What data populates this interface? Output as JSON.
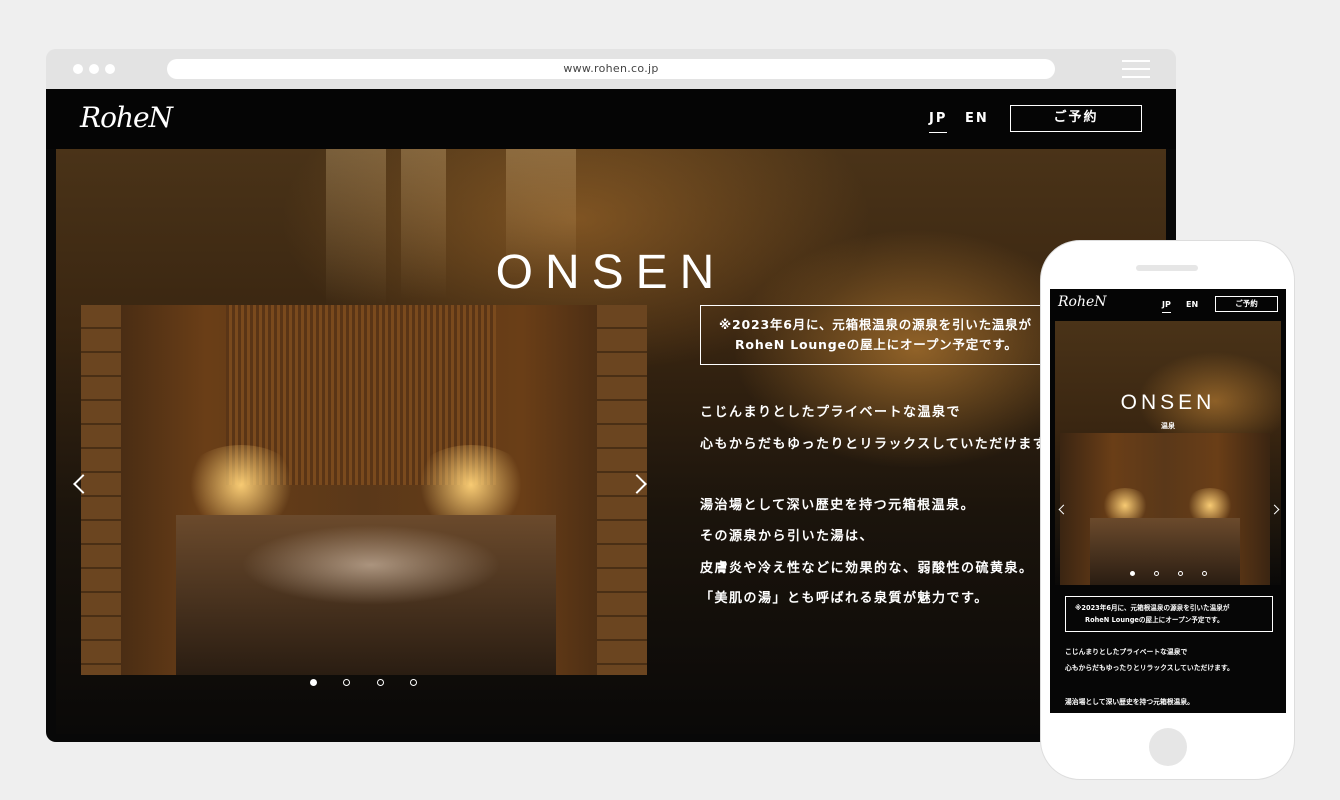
{
  "browser": {
    "url": "www.rohen.co.jp"
  },
  "site": {
    "logo": "RoheN",
    "lang_jp": "JP",
    "lang_en": "EN",
    "reserve_label": "ご予約",
    "hero_title": "ONSEN",
    "hero_subtitle": "温泉",
    "notice_line1": "※2023年6月に、元箱根温泉の源泉を引いた温泉が",
    "notice_line2": "RoheN Loungeの屋上にオープン予定です。",
    "paragraphs": [
      "こじんまりとしたプライベートな温泉で",
      "心もからだもゆったりとリラックスしていただけます。",
      "湯治場として深い歴史を持つ元箱根温泉。",
      "その源泉から引いた湯は、",
      "皮膚炎や冷え性などに効果的な、弱酸性の硫黄泉。",
      "「美肌の湯」とも呼ばれる泉質が魅力です。"
    ],
    "slider": {
      "count": 4,
      "active": 1
    }
  },
  "colors": {
    "page_bg": "#efefef",
    "site_bg": "#080808",
    "accent_text": "#ffffff"
  }
}
